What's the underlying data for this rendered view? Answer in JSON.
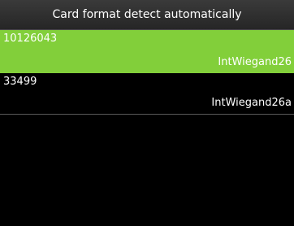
{
  "header": {
    "title": "Card format detect automatically"
  },
  "colors": {
    "selected_background": "#82cf3a",
    "background": "#000000",
    "text": "#ffffff"
  },
  "results": [
    {
      "card_number": "10126043",
      "format": "IntWiegand26",
      "selected": true
    },
    {
      "card_number": "33499",
      "format": "IntWiegand26a",
      "selected": false
    }
  ]
}
